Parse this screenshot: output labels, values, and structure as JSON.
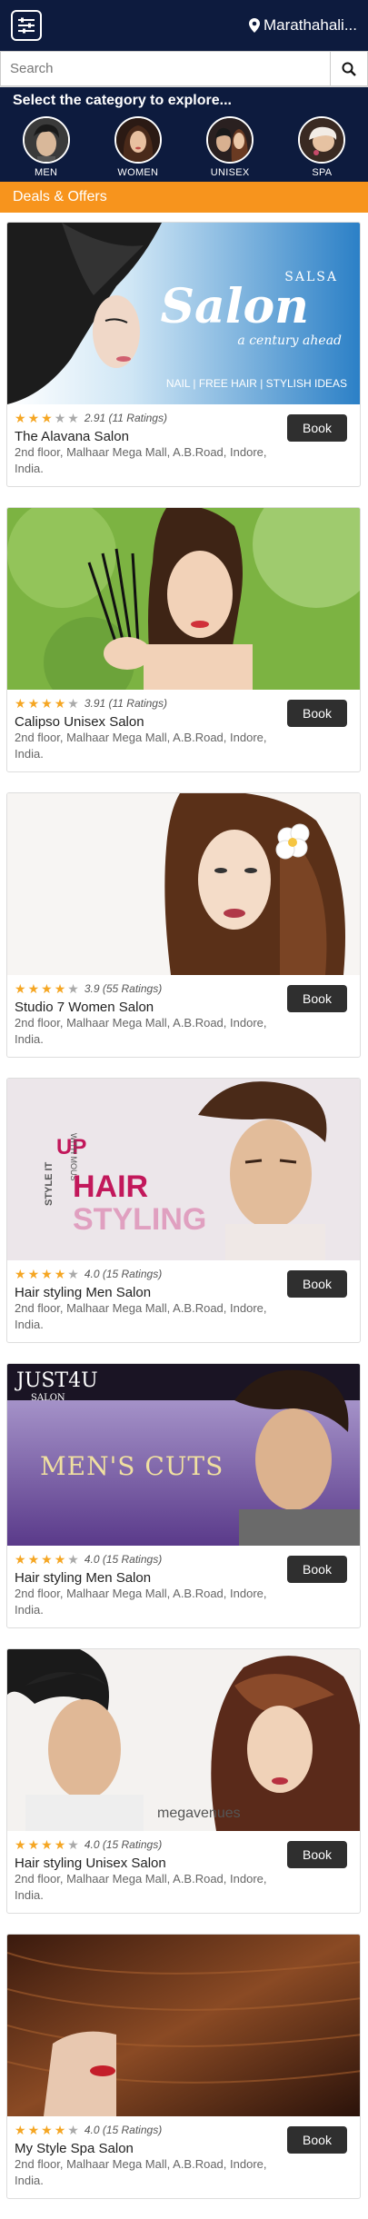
{
  "header": {
    "menu_icon": "sliders-icon",
    "location_icon": "map-pin-icon",
    "location": "Marathahali..."
  },
  "search": {
    "placeholder": "Search",
    "value": "",
    "icon": "search-icon"
  },
  "categories": {
    "title": "Select the category to explore...",
    "items": [
      {
        "label": "MEN"
      },
      {
        "label": "WOMEN"
      },
      {
        "label": "UNISEX"
      },
      {
        "label": "SPA"
      }
    ]
  },
  "deals": {
    "title": "Deals & Offers"
  },
  "salons": [
    {
      "rating": "2.91 (11 Ratings)",
      "stars": 3,
      "name": "The Alavana Salon",
      "address": "2nd floor, Malhaar Mega Mall, A.B.Road, Indore, India.",
      "book_label": "Book",
      "banner": {
        "brand": "SALSA",
        "title": "Salon",
        "tagline": "a century ahead",
        "footer": "NAIL | FREE HAIR | STYLISH IDEAS"
      }
    },
    {
      "rating": "3.91 (11 Ratings)",
      "stars": 4,
      "name": "Calipso Unisex Salon",
      "address": "2nd floor, Malhaar Mega Mall, A.B.Road, Indore, India.",
      "book_label": "Book"
    },
    {
      "rating": "3.9 (55 Ratings)",
      "stars": 4,
      "name": "Studio 7 Women Salon",
      "address": "2nd floor, Malhaar Mega Mall, A.B.Road, Indore, India.",
      "book_label": "Book"
    },
    {
      "rating": "4.0 (15 Ratings)",
      "stars": 4,
      "name": "Hair styling Men Salon",
      "address": "2nd floor, Malhaar Mega Mall, A.B.Road, Indore, India.",
      "book_label": "Book",
      "banner": {
        "side": "STYLE IT",
        "up": "UP",
        "with": "WITH MOUS",
        "hair": "HAIR",
        "styling": "STYLING"
      }
    },
    {
      "rating": "4.0 (15 Ratings)",
      "stars": 4,
      "name": "Hair styling Men Salon",
      "address": "2nd floor, Malhaar Mega Mall, A.B.Road, Indore, India.",
      "book_label": "Book",
      "banner": {
        "brand": "JUST4U",
        "sub": "SALON",
        "title": "MEN'S CUTS"
      }
    },
    {
      "rating": "4.0 (15 Ratings)",
      "stars": 4,
      "name": "Hair styling Unisex Salon",
      "address": "2nd floor, Malhaar Mega Mall, A.B.Road, Indore, India.",
      "book_label": "Book",
      "banner": {
        "watermark": "megavenues"
      }
    },
    {
      "rating": "4.0 (15 Ratings)",
      "stars": 4,
      "name": "My Style Spa Salon",
      "address": "2nd floor, Malhaar Mega Mall, A.B.Road, Indore, India.",
      "book_label": "Book"
    }
  ],
  "colors": {
    "navy": "#0d1b3e",
    "orange": "#f7941d",
    "star": "#f5a623",
    "button": "#2f2f2f"
  }
}
